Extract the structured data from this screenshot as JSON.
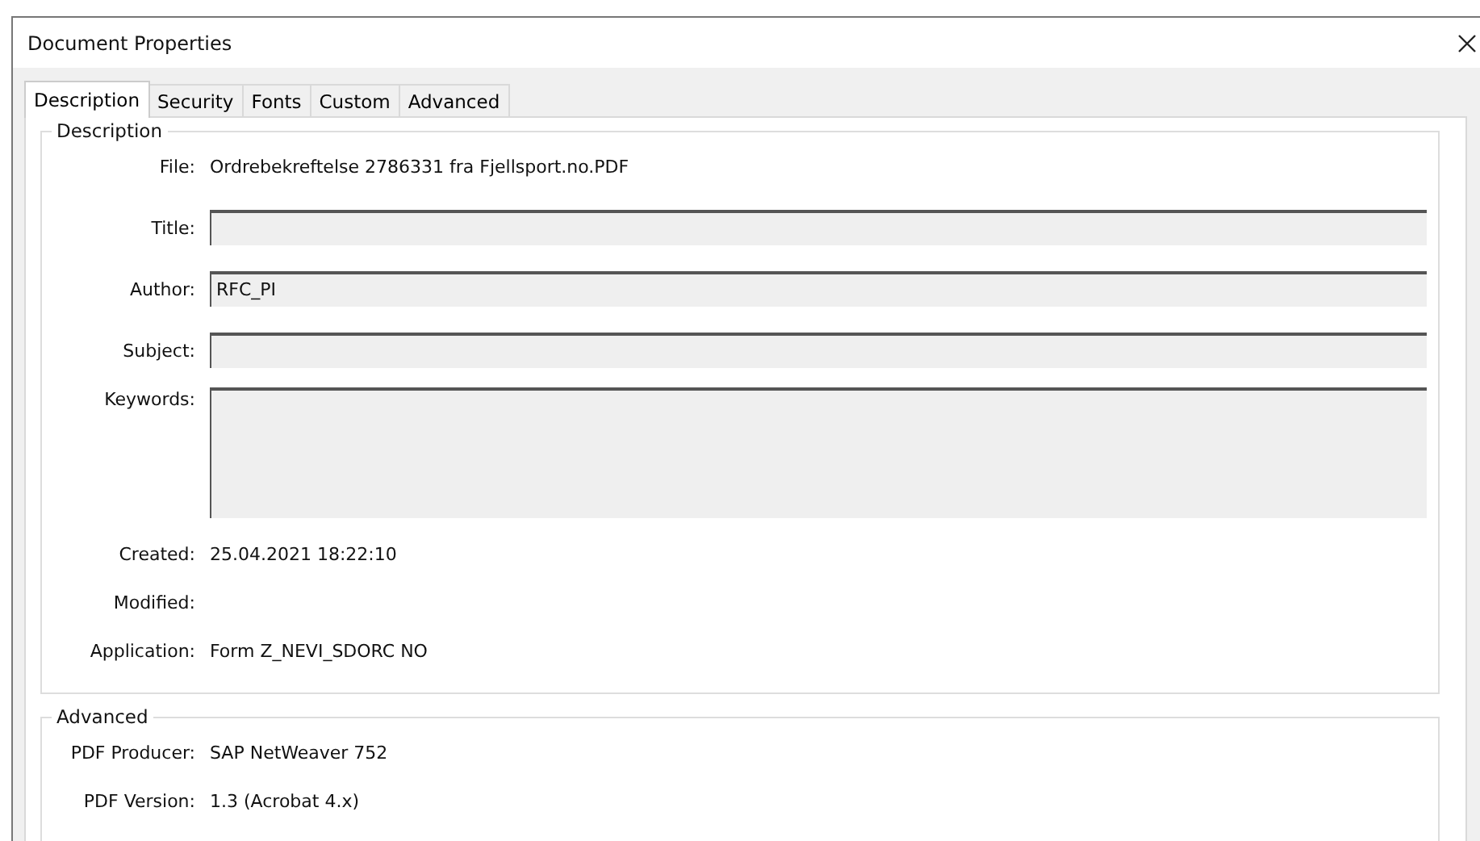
{
  "window": {
    "title": "Document Properties"
  },
  "tabs": [
    {
      "label": "Description",
      "selected": true
    },
    {
      "label": "Security",
      "selected": false
    },
    {
      "label": "Fonts",
      "selected": false
    },
    {
      "label": "Custom",
      "selected": false
    },
    {
      "label": "Advanced",
      "selected": false
    }
  ],
  "groups": [
    {
      "title": "Description",
      "rows": [
        {
          "kind": "info",
          "label": "File:",
          "value": "Ordrebekreftelse 2786331 fra Fjellsport.no.PDF"
        },
        {
          "kind": "field",
          "label": "Title:"
        },
        {
          "kind": "field",
          "label": "Author:",
          "value": "RFC_PI"
        },
        {
          "kind": "field",
          "label": "Subject:"
        },
        {
          "kind": "area",
          "label": "Keywords:"
        },
        {
          "kind": "info",
          "label": "Created:",
          "value": "25.04.2021 18:22:10"
        },
        {
          "kind": "info",
          "label": "Modified:"
        },
        {
          "kind": "info",
          "label": "Application:",
          "value": "Form Z_NEVI_SDORC NO"
        }
      ]
    },
    {
      "title": "Advanced",
      "rows": [
        {
          "kind": "info",
          "label": "PDF Producer:",
          "value": "SAP NetWeaver 752"
        },
        {
          "kind": "info",
          "label": "PDF Version:",
          "value": "1.3 (Acrobat 4.x)"
        }
      ]
    }
  ]
}
